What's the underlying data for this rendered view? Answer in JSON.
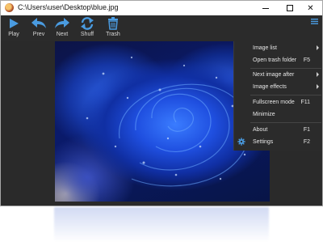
{
  "window": {
    "title": "C:\\Users\\user\\Desktop\\blue.jpg",
    "minimize_icon": "minimize-icon",
    "maximize_icon": "maximize-icon",
    "close_label": "✕"
  },
  "toolbar": {
    "play_label": "Play",
    "prev_label": "Prev",
    "next_label": "Next",
    "shuff_label": "Shuff",
    "trash_label": "Trash",
    "accent_color": "#4a9be0",
    "menu_icon": "hamburger-icon"
  },
  "image": {
    "subject": "blue rose with water droplets",
    "icon": "photo"
  },
  "menu": {
    "items": [
      {
        "label": "Image list",
        "key": "",
        "submenu": true
      },
      {
        "label": "Open trash folder",
        "key": "F5",
        "submenu": false
      },
      {
        "label": "Next image after",
        "key": "",
        "submenu": true
      },
      {
        "label": "Image effects",
        "key": "",
        "submenu": true
      },
      {
        "label": "Fullscreen mode",
        "key": "F11",
        "submenu": false
      },
      {
        "label": "Minimize",
        "key": "",
        "submenu": false
      },
      {
        "label": "About",
        "key": "F1",
        "submenu": false
      },
      {
        "label": "Settings",
        "key": "F2",
        "submenu": false
      }
    ],
    "settings_icon": "gear-icon"
  }
}
